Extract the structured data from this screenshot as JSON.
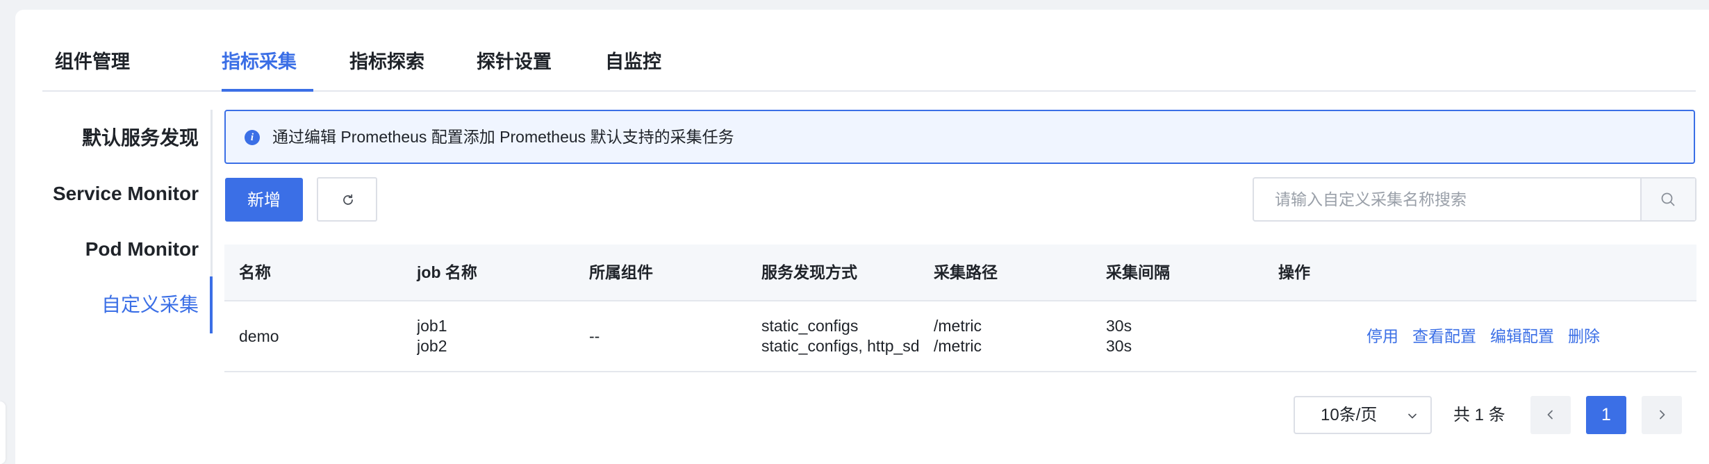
{
  "tabs": [
    {
      "label": "组件管理"
    },
    {
      "label": "指标采集",
      "active": true
    },
    {
      "label": "指标探索"
    },
    {
      "label": "探针设置"
    },
    {
      "label": "自监控"
    }
  ],
  "side_nav": [
    {
      "label": "默认服务发现"
    },
    {
      "label": "Service Monitor"
    },
    {
      "label": "Pod Monitor"
    },
    {
      "label": "自定义采集",
      "active": true
    }
  ],
  "info": {
    "icon": "info-icon",
    "text": "通过编辑 Prometheus 配置添加 Prometheus 默认支持的采集任务"
  },
  "toolbar": {
    "add_label": "新增",
    "refresh_icon": "refresh-icon",
    "search_placeholder": "请输入自定义采集名称搜索",
    "search_icon": "search-icon"
  },
  "table": {
    "columns": [
      "名称",
      "job 名称",
      "所属组件",
      "服务发现方式",
      "采集路径",
      "采集间隔",
      "操作"
    ],
    "rows": [
      {
        "name": "demo",
        "jobs": [
          "job1",
          "job2"
        ],
        "component": "--",
        "discovery": [
          "static_configs",
          "static_configs, http_sd_configs"
        ],
        "paths": [
          "/metric",
          "/metric"
        ],
        "intervals": [
          "30s",
          "30s"
        ],
        "actions": [
          "停用",
          "查看配置",
          "编辑配置",
          "删除"
        ]
      }
    ]
  },
  "pagination": {
    "page_size": "10条/页",
    "total": "共 1 条",
    "current_page": "1",
    "prev_icon": "chevron-left-icon",
    "next_icon": "chevron-right-icon"
  },
  "colors": {
    "accent": "#3b6fe6",
    "info_bg": "#f0f5ff",
    "header_bg": "#f5f7fa"
  }
}
